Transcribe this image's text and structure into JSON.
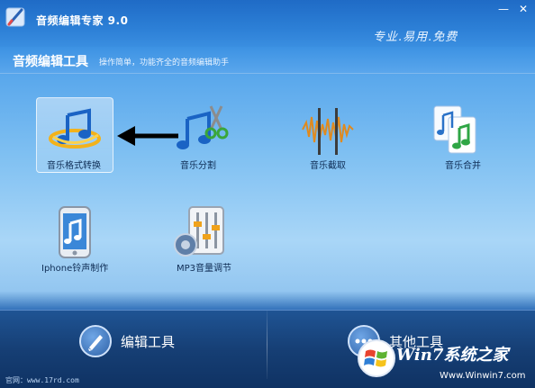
{
  "window": {
    "title": "音频编辑专家 9.0",
    "slogan": "专业.易用.免费",
    "minimize_glyph": "—",
    "close_glyph": "✕"
  },
  "header": {
    "title": "音频编辑工具",
    "subtitle": "操作简单，功能齐全的音频编辑助手"
  },
  "tools": [
    {
      "label": "音乐格式转换",
      "icon": "music-format-convert-icon",
      "selected": true
    },
    {
      "label": "音乐分割",
      "icon": "music-split-scissors-icon"
    },
    {
      "label": "音乐截取",
      "icon": "music-cut-waveform-icon"
    },
    {
      "label": "音乐合并",
      "icon": "music-merge-icon"
    },
    {
      "label": "Iphone铃声制作",
      "icon": "iphone-ringtone-icon"
    },
    {
      "label": "MP3音量调节",
      "icon": "mp3-volume-mixer-icon"
    }
  ],
  "bottom": {
    "edit_tools_label": "编辑工具",
    "other_tools_label": "其他工具"
  },
  "footer": {
    "url_text": "官网：www.17rd.com"
  },
  "watermark": {
    "brand": "Win7系统之家",
    "url": "Www.Winwin7.com"
  },
  "colors": {
    "accent": "#2c7fd6",
    "bottom_bar": "#163f75",
    "label_text": "#0f2d55"
  }
}
